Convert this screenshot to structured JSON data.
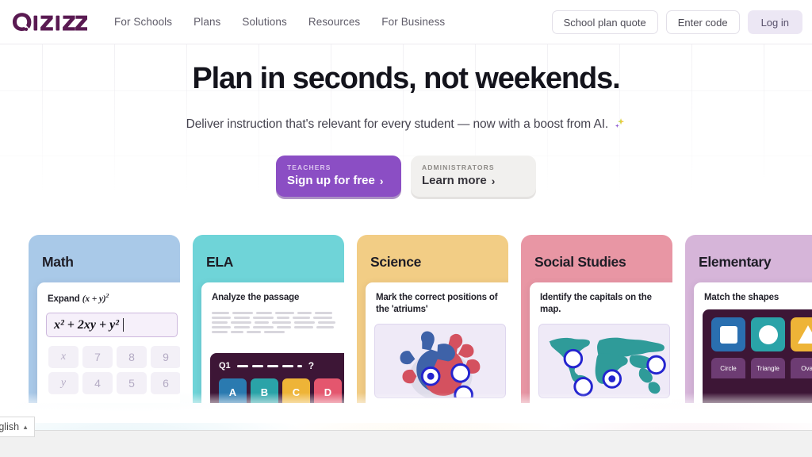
{
  "header": {
    "logo_text": "Quizizz",
    "nav": [
      {
        "label": "For Schools"
      },
      {
        "label": "Plans"
      },
      {
        "label": "Solutions"
      },
      {
        "label": "Resources"
      },
      {
        "label": "For Business"
      }
    ],
    "school_plan_quote": "School plan quote",
    "enter_code": "Enter code",
    "log_in": "Log in"
  },
  "hero": {
    "headline": "Plan in seconds, not weekends.",
    "subhead": "Deliver instruction that's relevant for every student — now with a boost from AI.",
    "sparkle_icon": "ai-sparkle-icon"
  },
  "ctas": {
    "teachers": {
      "kicker": "TEACHERS",
      "label": "Sign up for free",
      "chevron": "›",
      "color": "#8b4ec4"
    },
    "administrators": {
      "kicker": "ADMINISTRATORS",
      "label": "Learn more",
      "chevron": "›",
      "color": "#f1f0ee"
    }
  },
  "cards": [
    {
      "title": "Math",
      "header_color": "#a9c9e8",
      "prompt_prefix": "Expand ",
      "prompt_expr_base": "(x + y)",
      "prompt_expr_sup": "2",
      "answer": "x² + 2xy + y²",
      "keys": [
        "x",
        "7",
        "8",
        "9",
        "y",
        "4",
        "5",
        "6"
      ]
    },
    {
      "title": "ELA",
      "header_color": "#6fd4d8",
      "prompt": "Analyze the passage",
      "question_label": "Q1",
      "question_mark": "?",
      "options": [
        {
          "letter": "A",
          "color": "#2a7ab0"
        },
        {
          "letter": "B",
          "color": "#2aa3a8"
        },
        {
          "letter": "C",
          "color": "#eeb437"
        },
        {
          "letter": "D",
          "color": "#e4566e"
        }
      ]
    },
    {
      "title": "Science",
      "header_color": "#f2cd85",
      "prompt": "Mark the correct positions of the 'atriums'",
      "image": "heart-diagram"
    },
    {
      "title": "Social Studies",
      "header_color": "#e896a4",
      "prompt": "Identify the capitals on the map.",
      "image": "world-map"
    },
    {
      "title": "Elementary",
      "header_color": "#d6b5d9",
      "prompt": "Match the shapes",
      "shapes": [
        {
          "glyph": "square",
          "color": "#2a6fb0"
        },
        {
          "glyph": "circle",
          "color": "#2aa3a8"
        },
        {
          "glyph": "triangle",
          "color": "#eeb437"
        }
      ],
      "labels": [
        "Circle",
        "Triangle",
        "Oval"
      ]
    }
  ],
  "bottom": {
    "language": "glish",
    "caret": "▲"
  }
}
